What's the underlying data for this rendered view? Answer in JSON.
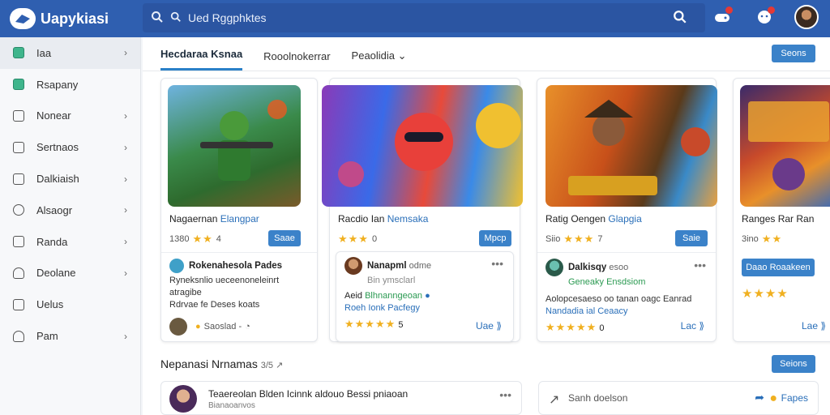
{
  "app": {
    "title": "Uapykiasi"
  },
  "search": {
    "placeholder": "Ued Rggphktes"
  },
  "sidebar": {
    "items": [
      {
        "label": "Iaa",
        "chev": "›"
      },
      {
        "label": "Rsapany",
        "chev": ""
      },
      {
        "label": "Nonear",
        "chev": "›"
      },
      {
        "label": "Sertnaos",
        "chev": "›"
      },
      {
        "label": "Dalkiaish",
        "chev": "›"
      },
      {
        "label": "Alsaogr",
        "chev": "›"
      },
      {
        "label": "Randa",
        "chev": "›"
      },
      {
        "label": "Deolane",
        "chev": "›"
      },
      {
        "label": "Uelus",
        "chev": ""
      },
      {
        "label": "Pam",
        "chev": "›"
      }
    ]
  },
  "tabs": [
    {
      "label": "Hecdaraa Ksnaa"
    },
    {
      "label": "Rooolnokerrar"
    },
    {
      "label": "Peaolidia ⌄"
    }
  ],
  "tab_button": "Seons",
  "cards": [
    {
      "title": "Nagaernan",
      "title_hl": "Elangpar",
      "rating_text": "1380",
      "stars": "★★",
      "rating_num": "4",
      "button": "Saae",
      "rev_name": "Rokenahesola Pades",
      "rev_text": "Ryneksnlio ueceenoneleinrt atragibe\nRdrvae fe Deses koats",
      "rev_foot": "Saoslad -"
    },
    {
      "title": "Racdio Ian",
      "title_hl": "Nemsaka",
      "rating_text": "",
      "stars": "★★★",
      "rating_num": "0",
      "button": "Mpcp",
      "rev_name": "Nanapml",
      "rev_meta": "odme",
      "rev_line2": "Bin ymsclarl",
      "rev_line3a": "Aeid",
      "rev_line3b": "Blhnanngeoan",
      "rev_line4": "Roeh Ionk Pacfegy",
      "rev_stars": "★★★★★",
      "rev_num": "5",
      "like": "Uae ⟫"
    },
    {
      "title": "Ratig Oengen",
      "title_hl": "Glapgia",
      "rating_text": "Siio",
      "stars": "★★★",
      "rating_num": "7",
      "button": "Saie",
      "rev_name": "Dalkisqy",
      "rev_meta": "esoo",
      "rev_line2": "Geneaky Ensdsiom",
      "rev_line3": "Aolopcesaeso oo tanan oagc Eanrad",
      "rev_line4": "Nandadia ial Ceaacy",
      "rev_stars": "★★★★★",
      "rev_num": "0",
      "like": "Lac ⟫"
    },
    {
      "title": "Ranges Rar",
      "title_hl": "Ran",
      "rating_text": "3ino",
      "stars": "★★",
      "rating_num": "",
      "button": "Daao Roaakeen",
      "rev_stars": "★★★★",
      "like": "Lae ⟫"
    }
  ],
  "section": {
    "title": "Nepanasi Nrnamas",
    "meta": "3/5 ↗",
    "button": "Seions"
  },
  "rows": [
    {
      "title": "Teaereolan Blden Icinnk aldouo Bessi pniaoan",
      "sub": "Bianaoanvos",
      "stars": "★★★★"
    },
    {
      "placeholder": "Sanh doelson",
      "action": "Fapes"
    }
  ],
  "colors": {
    "primary": "#2f5fb0",
    "accent": "#3b82c9",
    "star": "#f0b020",
    "link": "#2a6fb9"
  }
}
